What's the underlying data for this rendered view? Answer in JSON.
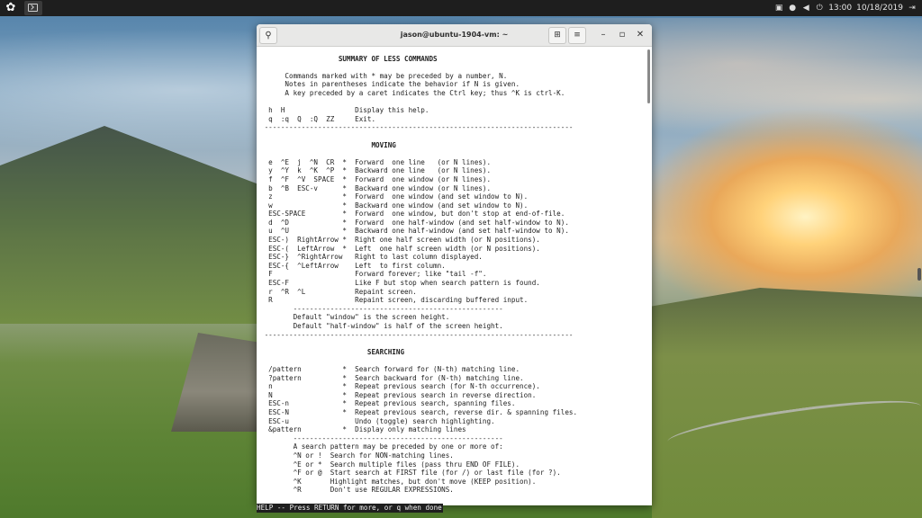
{
  "topbar": {
    "time": "13:00",
    "date": "10/18/2019",
    "icons": [
      "activities-icon",
      "terminal-icon",
      "network-icon",
      "notification-icon",
      "volume-icon",
      "power-icon"
    ]
  },
  "terminal": {
    "title": "jason@ubuntu-1904-vm: ~",
    "lines": [
      "",
      "                   SUMMARY OF LESS COMMANDS",
      "",
      "      Commands marked with * may be preceded by a number, N.",
      "      Notes in parentheses indicate the behavior if N is given.",
      "      A key preceded by a caret indicates the Ctrl key; thus ^K is ctrl-K.",
      "",
      "  h  H                 Display this help.",
      "  q  :q  Q  :Q  ZZ     Exit.",
      " ---------------------------------------------------------------------------",
      "",
      "                           MOVING",
      "",
      "  e  ^E  j  ^N  CR  *  Forward  one line   (or N lines).",
      "  y  ^Y  k  ^K  ^P  *  Backward one line   (or N lines).",
      "  f  ^F  ^V  SPACE  *  Forward  one window (or N lines).",
      "  b  ^B  ESC-v      *  Backward one window (or N lines).",
      "  z                 *  Forward  one window (and set window to N).",
      "  w                 *  Backward one window (and set window to N).",
      "  ESC-SPACE         *  Forward  one window, but don't stop at end-of-file.",
      "  d  ^D             *  Forward  one half-window (and set half-window to N).",
      "  u  ^U             *  Backward one half-window (and set half-window to N).",
      "  ESC-)  RightArrow *  Right one half screen width (or N positions).",
      "  ESC-(  LeftArrow  *  Left  one half screen width (or N positions).",
      "  ESC-}  ^RightArrow   Right to last column displayed.",
      "  ESC-{  ^LeftArrow    Left  to first column.",
      "  F                    Forward forever; like \"tail -f\".",
      "  ESC-F                Like F but stop when search pattern is found.",
      "  r  ^R  ^L            Repaint screen.",
      "  R                    Repaint screen, discarding buffered input.",
      "        ---------------------------------------------------",
      "        Default \"window\" is the screen height.",
      "        Default \"half-window\" is half of the screen height.",
      " ---------------------------------------------------------------------------",
      "",
      "                          SEARCHING",
      "",
      "  /pattern          *  Search forward for (N-th) matching line.",
      "  ?pattern          *  Search backward for (N-th) matching line.",
      "  n                 *  Repeat previous search (for N-th occurrence).",
      "  N                 *  Repeat previous search in reverse direction.",
      "  ESC-n             *  Repeat previous search, spanning files.",
      "  ESC-N             *  Repeat previous search, reverse dir. & spanning files.",
      "  ESC-u                Undo (toggle) search highlighting.",
      "  &pattern          *  Display only matching lines",
      "        ---------------------------------------------------",
      "        A search pattern may be preceded by one or more of:",
      "        ^N or !  Search for NON-matching lines.",
      "        ^E or *  Search multiple files (pass thru END OF FILE).",
      "        ^F or @  Start search at FIRST file (for /) or last file (for ?).",
      "        ^K       Highlight matches, but don't move (KEEP position).",
      "        ^R       Don't use REGULAR EXPRESSIONS."
    ],
    "status": "HELP -- Press RETURN for more, or q when done"
  }
}
